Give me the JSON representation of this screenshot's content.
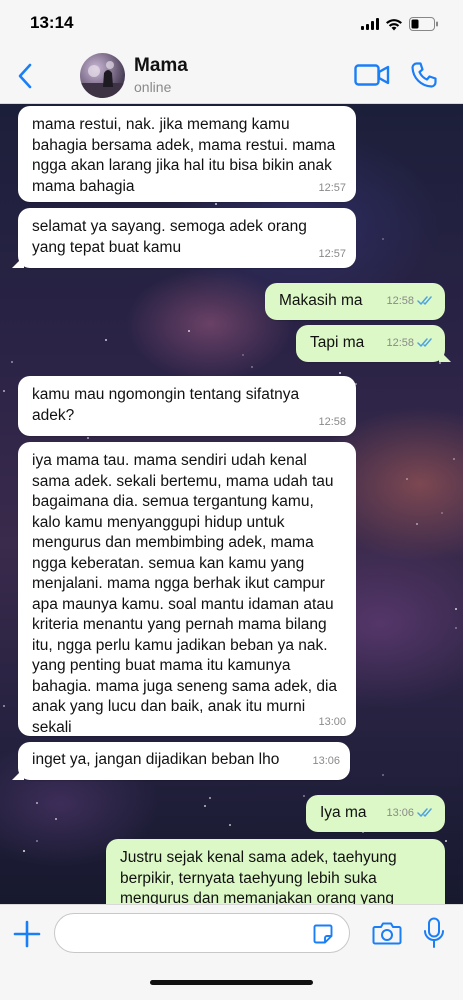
{
  "status_bar": {
    "time": "13:14"
  },
  "header": {
    "contact_name": "Mama",
    "contact_status": "online"
  },
  "colors": {
    "accent": "#1a7ef7",
    "incoming_bubble": "#ffffff",
    "outgoing_bubble": "#dcf8c6",
    "read_tick": "#4fa3e0"
  },
  "icons": {
    "back": "chevron-left-icon",
    "video": "video-camera-icon",
    "call": "phone-icon",
    "add": "plus-icon",
    "sticker": "sticker-icon",
    "camera": "camera-icon",
    "mic": "microphone-icon"
  },
  "messages": [
    {
      "direction": "in",
      "text": "mama restui, nak. jika memang kamu bahagia bersama adek, mama restui. mama ngga akan larang jika hal itu bisa bikin anak mama bahagia",
      "time": "12:57"
    },
    {
      "direction": "in",
      "text": "selamat ya sayang. semoga adek orang yang tepat buat kamu",
      "time": "12:57"
    },
    {
      "direction": "out",
      "text": "Makasih ma",
      "time": "12:58",
      "read": true
    },
    {
      "direction": "out",
      "text": "Tapi ma",
      "time": "12:58",
      "read": true
    },
    {
      "direction": "in",
      "text": "kamu mau ngomongin tentang sifatnya adek?",
      "time": "12:58"
    },
    {
      "direction": "in",
      "text": "iya mama tau. mama sendiri udah kenal sama adek. sekali bertemu, mama udah tau bagaimana dia. semua tergantung kamu, kalo kamu menyanggupi hidup untuk mengurus dan membimbing adek, mama ngga keberatan. semua kan kamu yang menjalani. mama ngga berhak ikut campur apa maunya kamu. soal mantu idaman atau kriteria menantu yang pernah mama bilang itu, ngga perlu kamu jadikan beban ya nak. yang penting buat mama itu kamunya bahagia. mama juga seneng sama adek, dia anak yang lucu dan baik, anak itu murni sekali",
      "time": "13:00"
    },
    {
      "direction": "in",
      "text": "inget ya, jangan dijadikan beban lho",
      "time": "13:06"
    },
    {
      "direction": "out",
      "text": "Iya ma",
      "time": "13:06",
      "read": true
    },
    {
      "direction": "out",
      "text": "Justru sejak kenal sama adek, taehyung berpikir, ternyata taehyung lebih suka mengurus dan memanjakan orang yang",
      "time": ""
    }
  ],
  "composer": {
    "value": "",
    "placeholder": ""
  }
}
